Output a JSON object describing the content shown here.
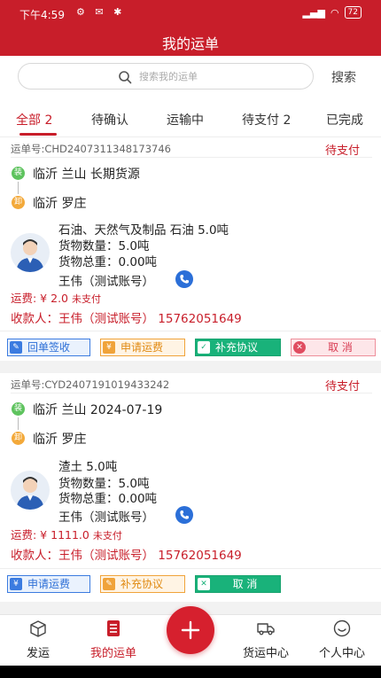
{
  "status_bar": {
    "time": "下午4:59",
    "battery": "72"
  },
  "header": {
    "title": "我的运单"
  },
  "search": {
    "placeholder": "搜索我的运单",
    "button_label": "搜索"
  },
  "tabs": [
    {
      "label": "全部 2",
      "active": true
    },
    {
      "label": "待确认",
      "active": false
    },
    {
      "label": "运输中",
      "active": false
    },
    {
      "label": "待支付 2",
      "active": false
    },
    {
      "label": "已完成",
      "active": false
    }
  ],
  "orders": [
    {
      "order_no": "运单号:CHD2407311348173746",
      "status": "待支付",
      "load_badge": "装",
      "unload_badge": "卸",
      "origin": "临沂 兰山    长期货源",
      "destination": "临沂 罗庄",
      "cargo": "石油、天然气及制品  石油 5.0吨",
      "quantity": "货物数量：5.0吨",
      "weight": "货物总重：0.00吨",
      "driver": "王伟（测试账号）",
      "fee": "运费: ¥ 2.0",
      "fee_status": "未支付",
      "payee": "收款人：王伟（测试账号）   15762051649",
      "actions": [
        "回单签收",
        "申请运费",
        "补充协议",
        "取  消"
      ]
    },
    {
      "order_no": "运单号:CYD2407191019433242",
      "status": "待支付",
      "load_badge": "装",
      "unload_badge": "卸",
      "origin": "临沂 兰山   2024-07-19",
      "destination": "临沂 罗庄",
      "cargo": "渣土   5.0吨",
      "quantity": "货物数量：5.0吨",
      "weight": "货物总重：0.00吨",
      "driver": "王伟（测试账号）",
      "fee": "运费: ¥ 1111.0",
      "fee_status": "未支付",
      "payee": "收款人：王伟（测试账号）   15762051649",
      "actions": [
        "申请运费",
        "补充协议",
        "取  消"
      ]
    }
  ],
  "bottom_nav": [
    {
      "label": "发运",
      "icon": "box-icon"
    },
    {
      "label": "我的运单",
      "icon": "list-icon",
      "active": true
    },
    {
      "label": "货运中心",
      "icon": "truck-icon"
    },
    {
      "label": "个人中心",
      "icon": "smile-icon"
    }
  ],
  "colors": {
    "primary": "#c81e2a",
    "blue": "#3b7be0",
    "orange": "#f0a33a",
    "green": "#19b27a"
  }
}
